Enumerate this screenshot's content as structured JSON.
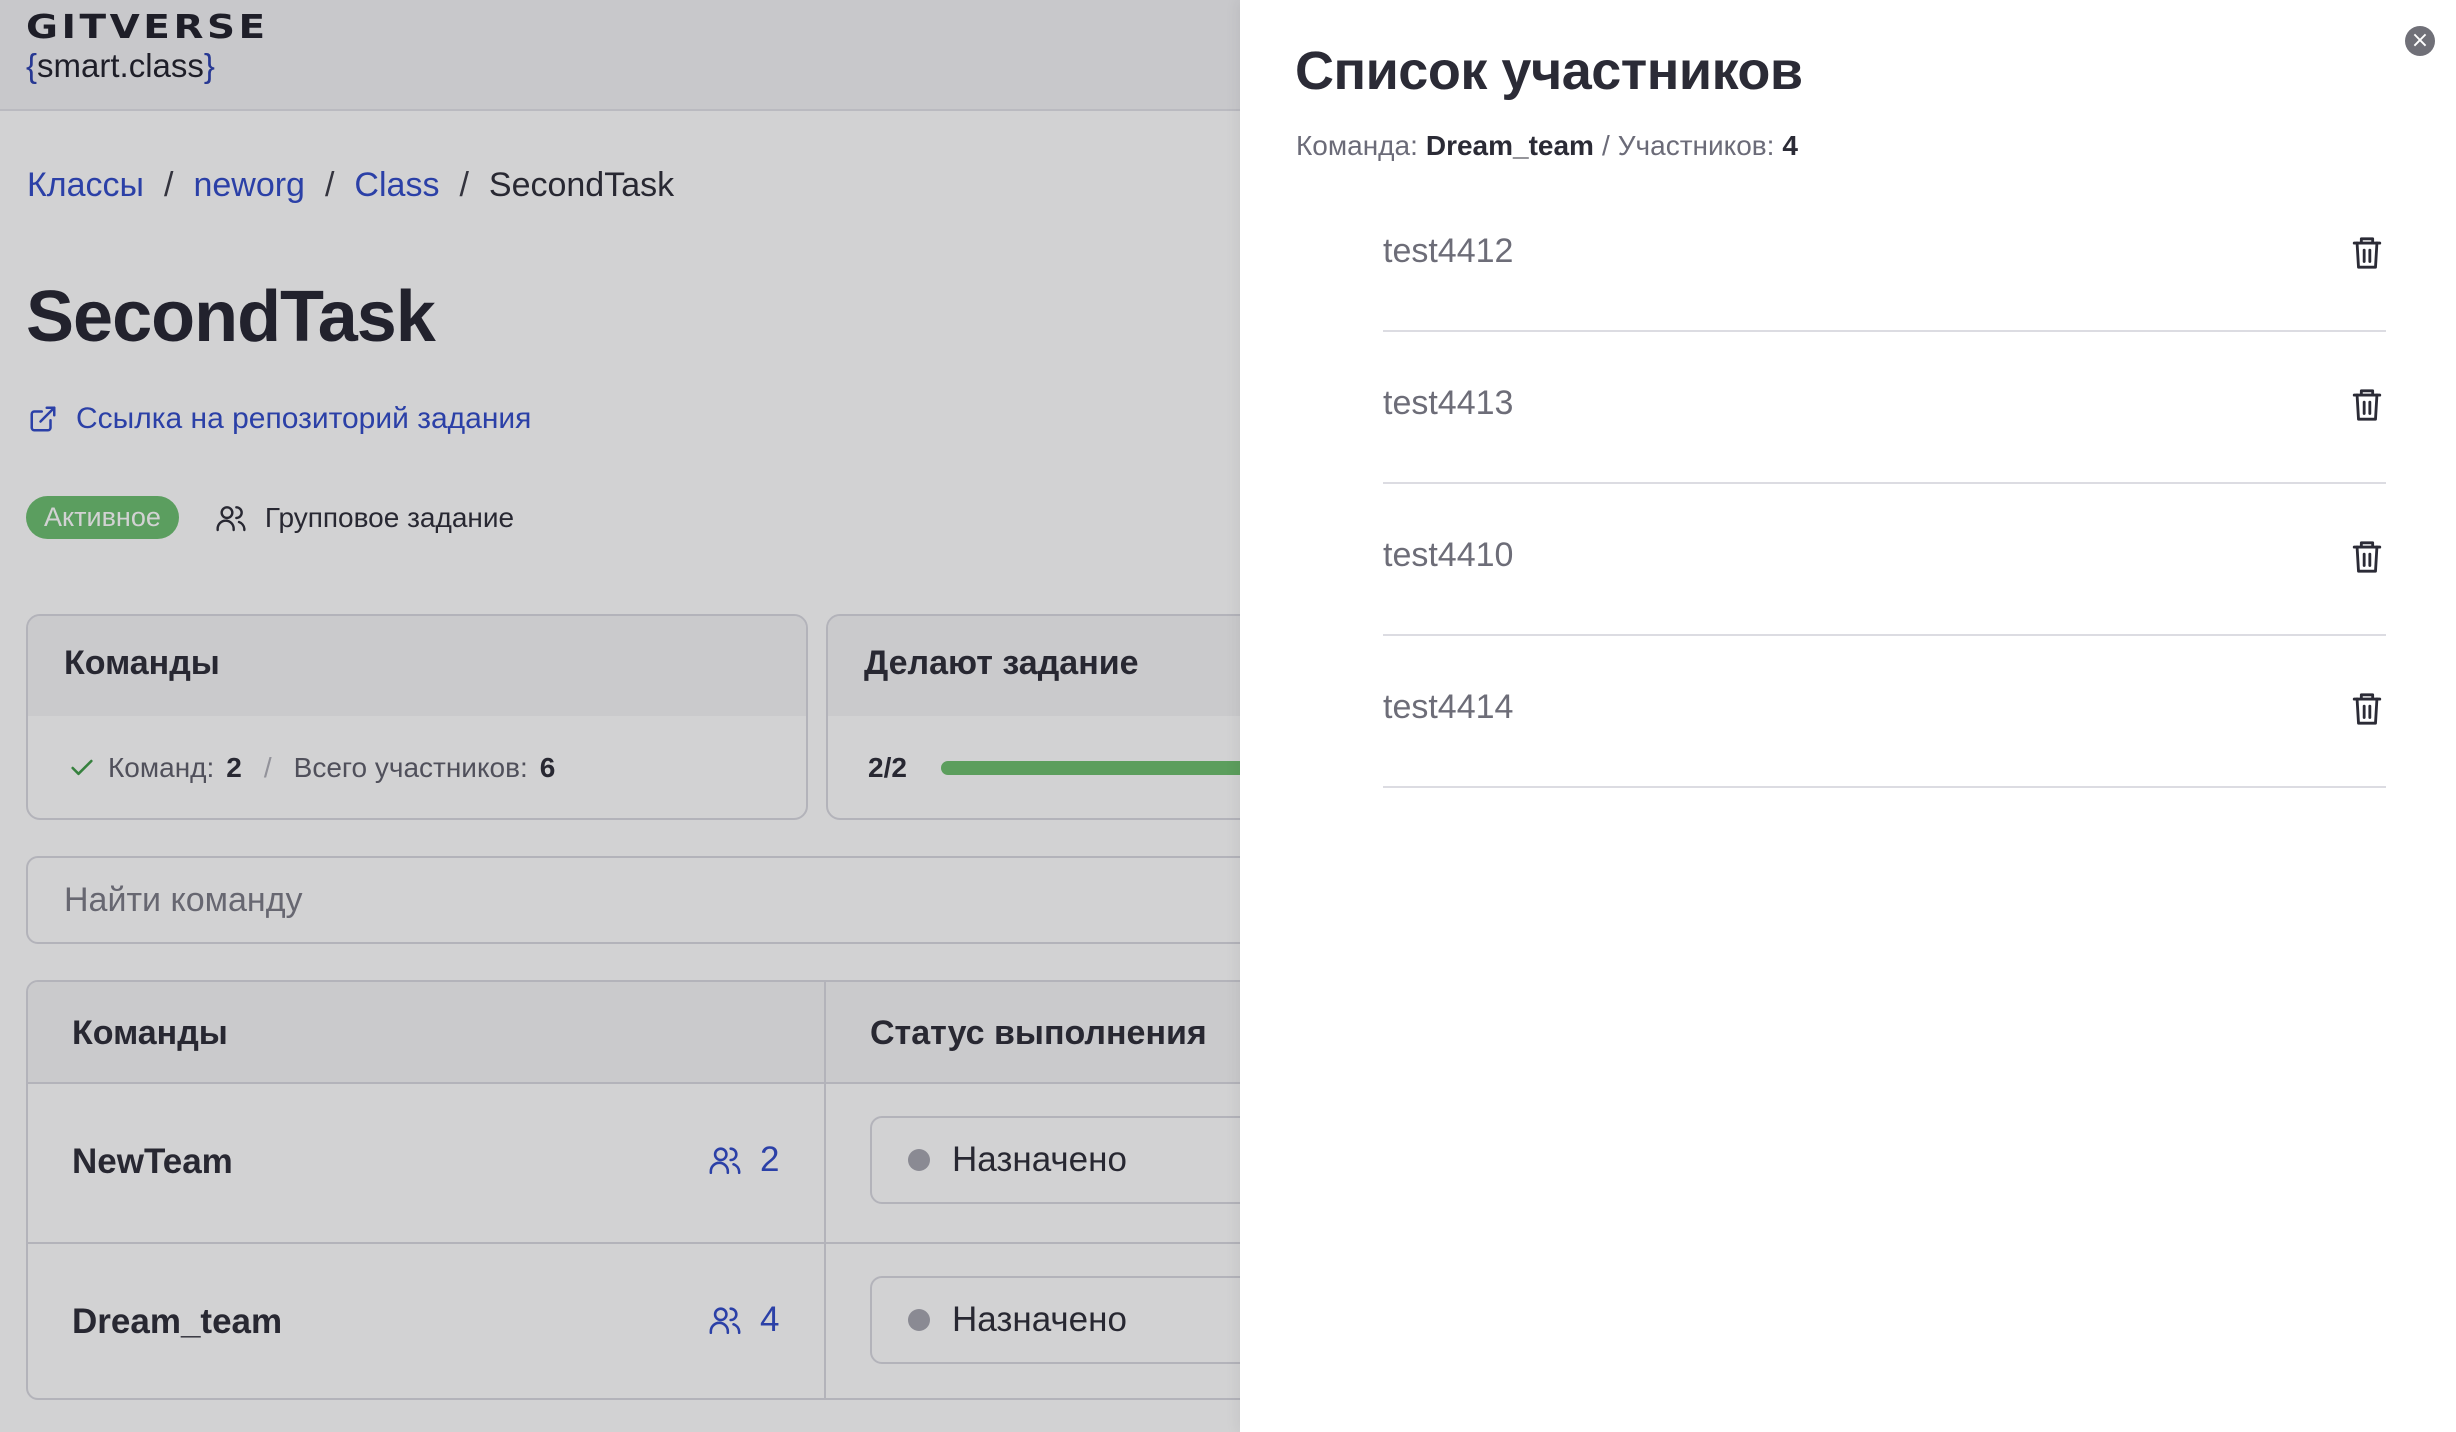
{
  "header": {
    "logo_top": "GITVERSE",
    "logo_open": "{",
    "logo_text": "smart.class",
    "logo_close": "}"
  },
  "breadcrumb": {
    "items": [
      "Классы",
      "neworg",
      "Class"
    ],
    "separator": "/",
    "current": "SecondTask"
  },
  "task": {
    "title": "SecondTask",
    "repo_link": "Ссылка на репозиторий задания",
    "status_badge": "Активное",
    "type_label": "Групповое задание"
  },
  "cards": {
    "teams": {
      "title": "Команды",
      "teams_label": "Команд:",
      "teams_value": "2",
      "sep": "/",
      "members_label": "Всего участников:",
      "members_value": "6"
    },
    "doing": {
      "title": "Делают задание",
      "progress_text": "2/2",
      "progress_fraction": 1.0
    }
  },
  "search": {
    "placeholder": "Найти команду"
  },
  "table": {
    "headers": [
      "Команды",
      "Статус выполнения"
    ],
    "rows": [
      {
        "team": "NewTeam",
        "members": "2",
        "status": "Назначено"
      },
      {
        "team": "Dream_team",
        "members": "4",
        "status": "Назначено"
      }
    ]
  },
  "drawer": {
    "title": "Список участников",
    "team_label": "Команда:",
    "team_value": "Dream_team",
    "sep": "/",
    "count_label": "Участников:",
    "count_value": "4",
    "close_icon": "close-icon",
    "members": [
      "test4412",
      "test4413",
      "test4410",
      "test4414"
    ]
  },
  "colors": {
    "accent": "#2f49c9",
    "success": "#6bbf6e",
    "overlay": "rgba(30,30,36,0.2)"
  }
}
